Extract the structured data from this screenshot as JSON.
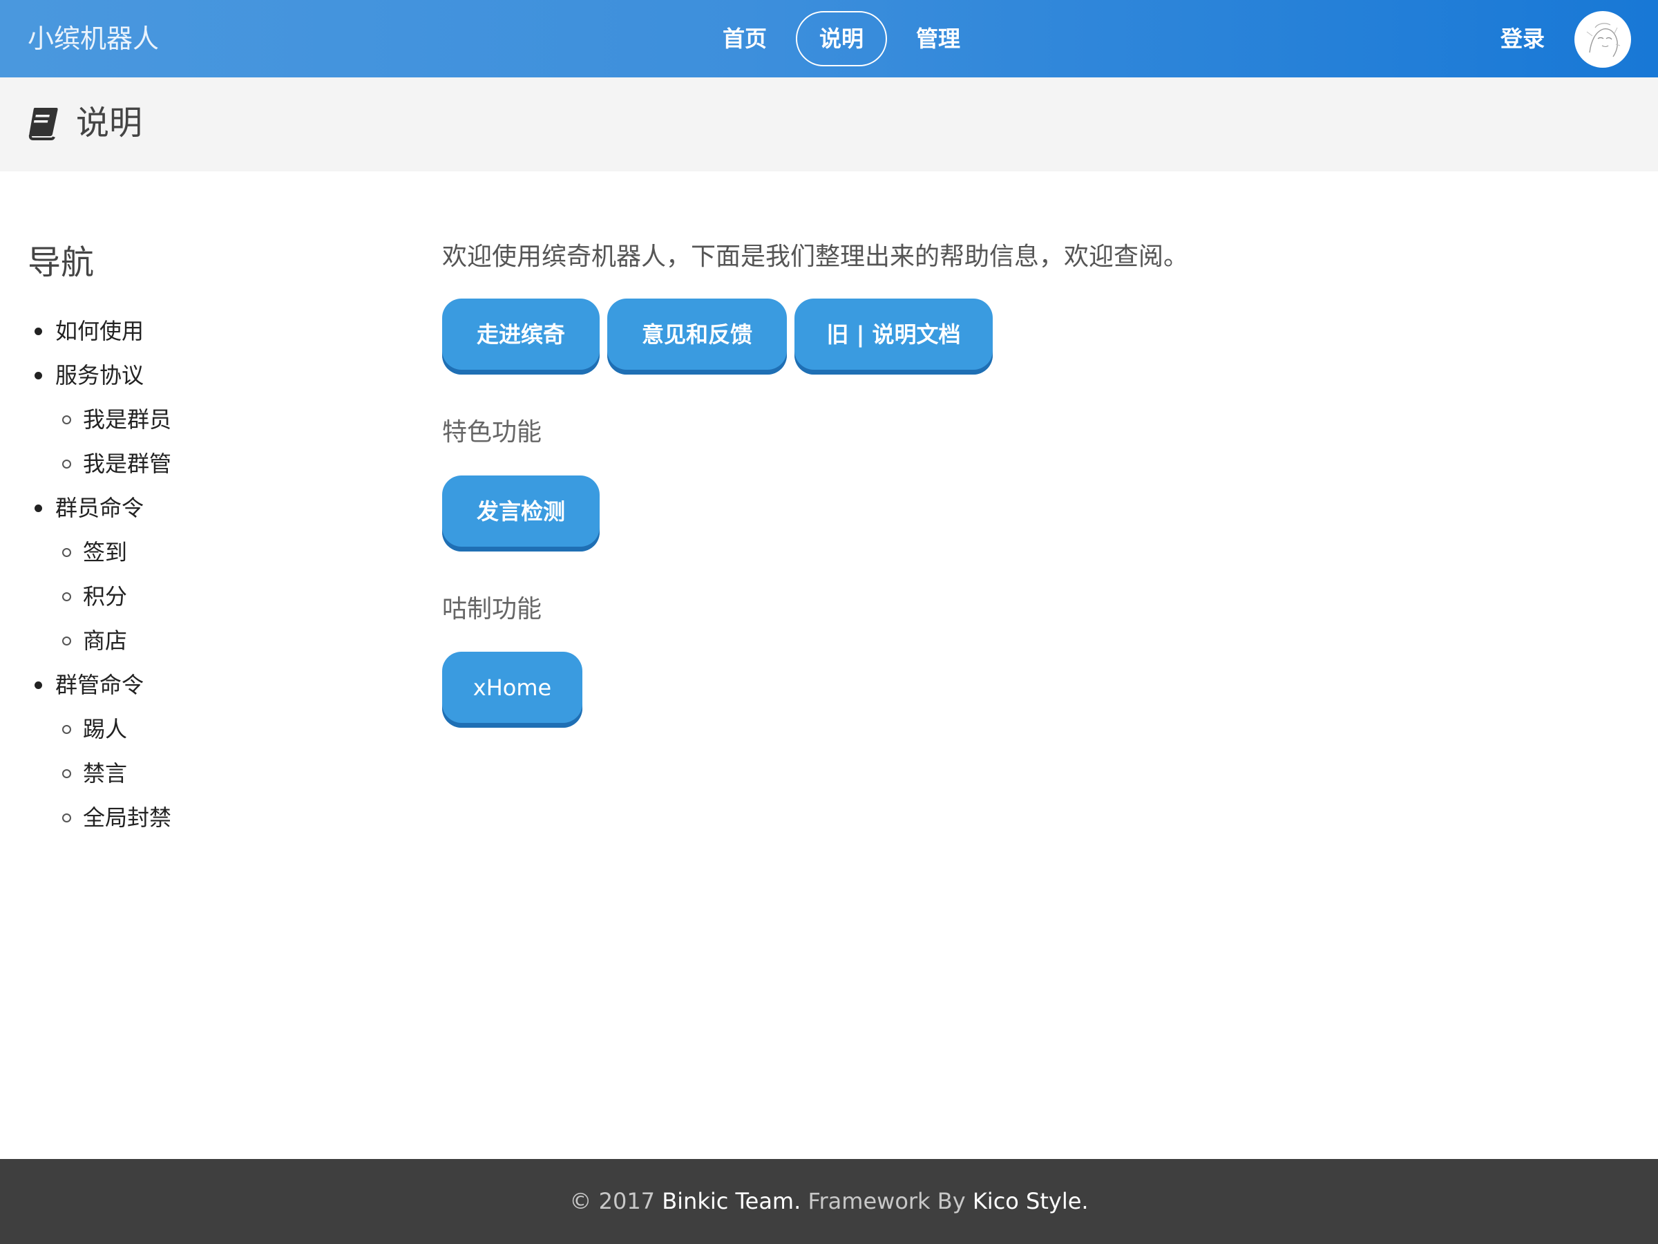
{
  "header": {
    "brand": "小缤机器人",
    "nav": [
      {
        "label": "首页",
        "active": false
      },
      {
        "label": "说明",
        "active": true
      },
      {
        "label": "管理",
        "active": false
      }
    ],
    "login_label": "登录"
  },
  "page": {
    "title": "说明",
    "icon": "book-icon"
  },
  "sidebar": {
    "title": "导航",
    "items": [
      {
        "label": "如何使用",
        "level": 1
      },
      {
        "label": "服务协议",
        "level": 1
      },
      {
        "label": "我是群员",
        "level": 2
      },
      {
        "label": "我是群管",
        "level": 2
      },
      {
        "label": "群员命令",
        "level": 1
      },
      {
        "label": "签到",
        "level": 2
      },
      {
        "label": "积分",
        "level": 2
      },
      {
        "label": "商店",
        "level": 2
      },
      {
        "label": "群管命令",
        "level": 1
      },
      {
        "label": "踢人",
        "level": 2
      },
      {
        "label": "禁言",
        "level": 2
      },
      {
        "label": "全局封禁",
        "level": 2
      }
    ]
  },
  "main": {
    "intro": "欢迎使用缤奇机器人，下面是我们整理出来的帮助信息，欢迎查阅。",
    "primary_buttons": [
      "走进缤奇",
      "意见和反馈",
      "旧 | 说明文档"
    ],
    "sections": [
      {
        "title": "特色功能",
        "buttons": [
          "发言检测"
        ]
      },
      {
        "title": "咕制功能",
        "buttons": [
          "xHome"
        ]
      }
    ]
  },
  "footer": {
    "copyright": "© 2017",
    "team": "Binkic Team.",
    "framework_by": "Framework By",
    "framework": "Kico Style."
  },
  "colors": {
    "nav_gradient_start": "#4a98de",
    "nav_gradient_end": "#1878d6",
    "button": "#3a9be0",
    "button_shadow": "#1f6fb4",
    "footer_bg": "#3f3f3f",
    "pagehead_bg": "#f4f4f4"
  }
}
